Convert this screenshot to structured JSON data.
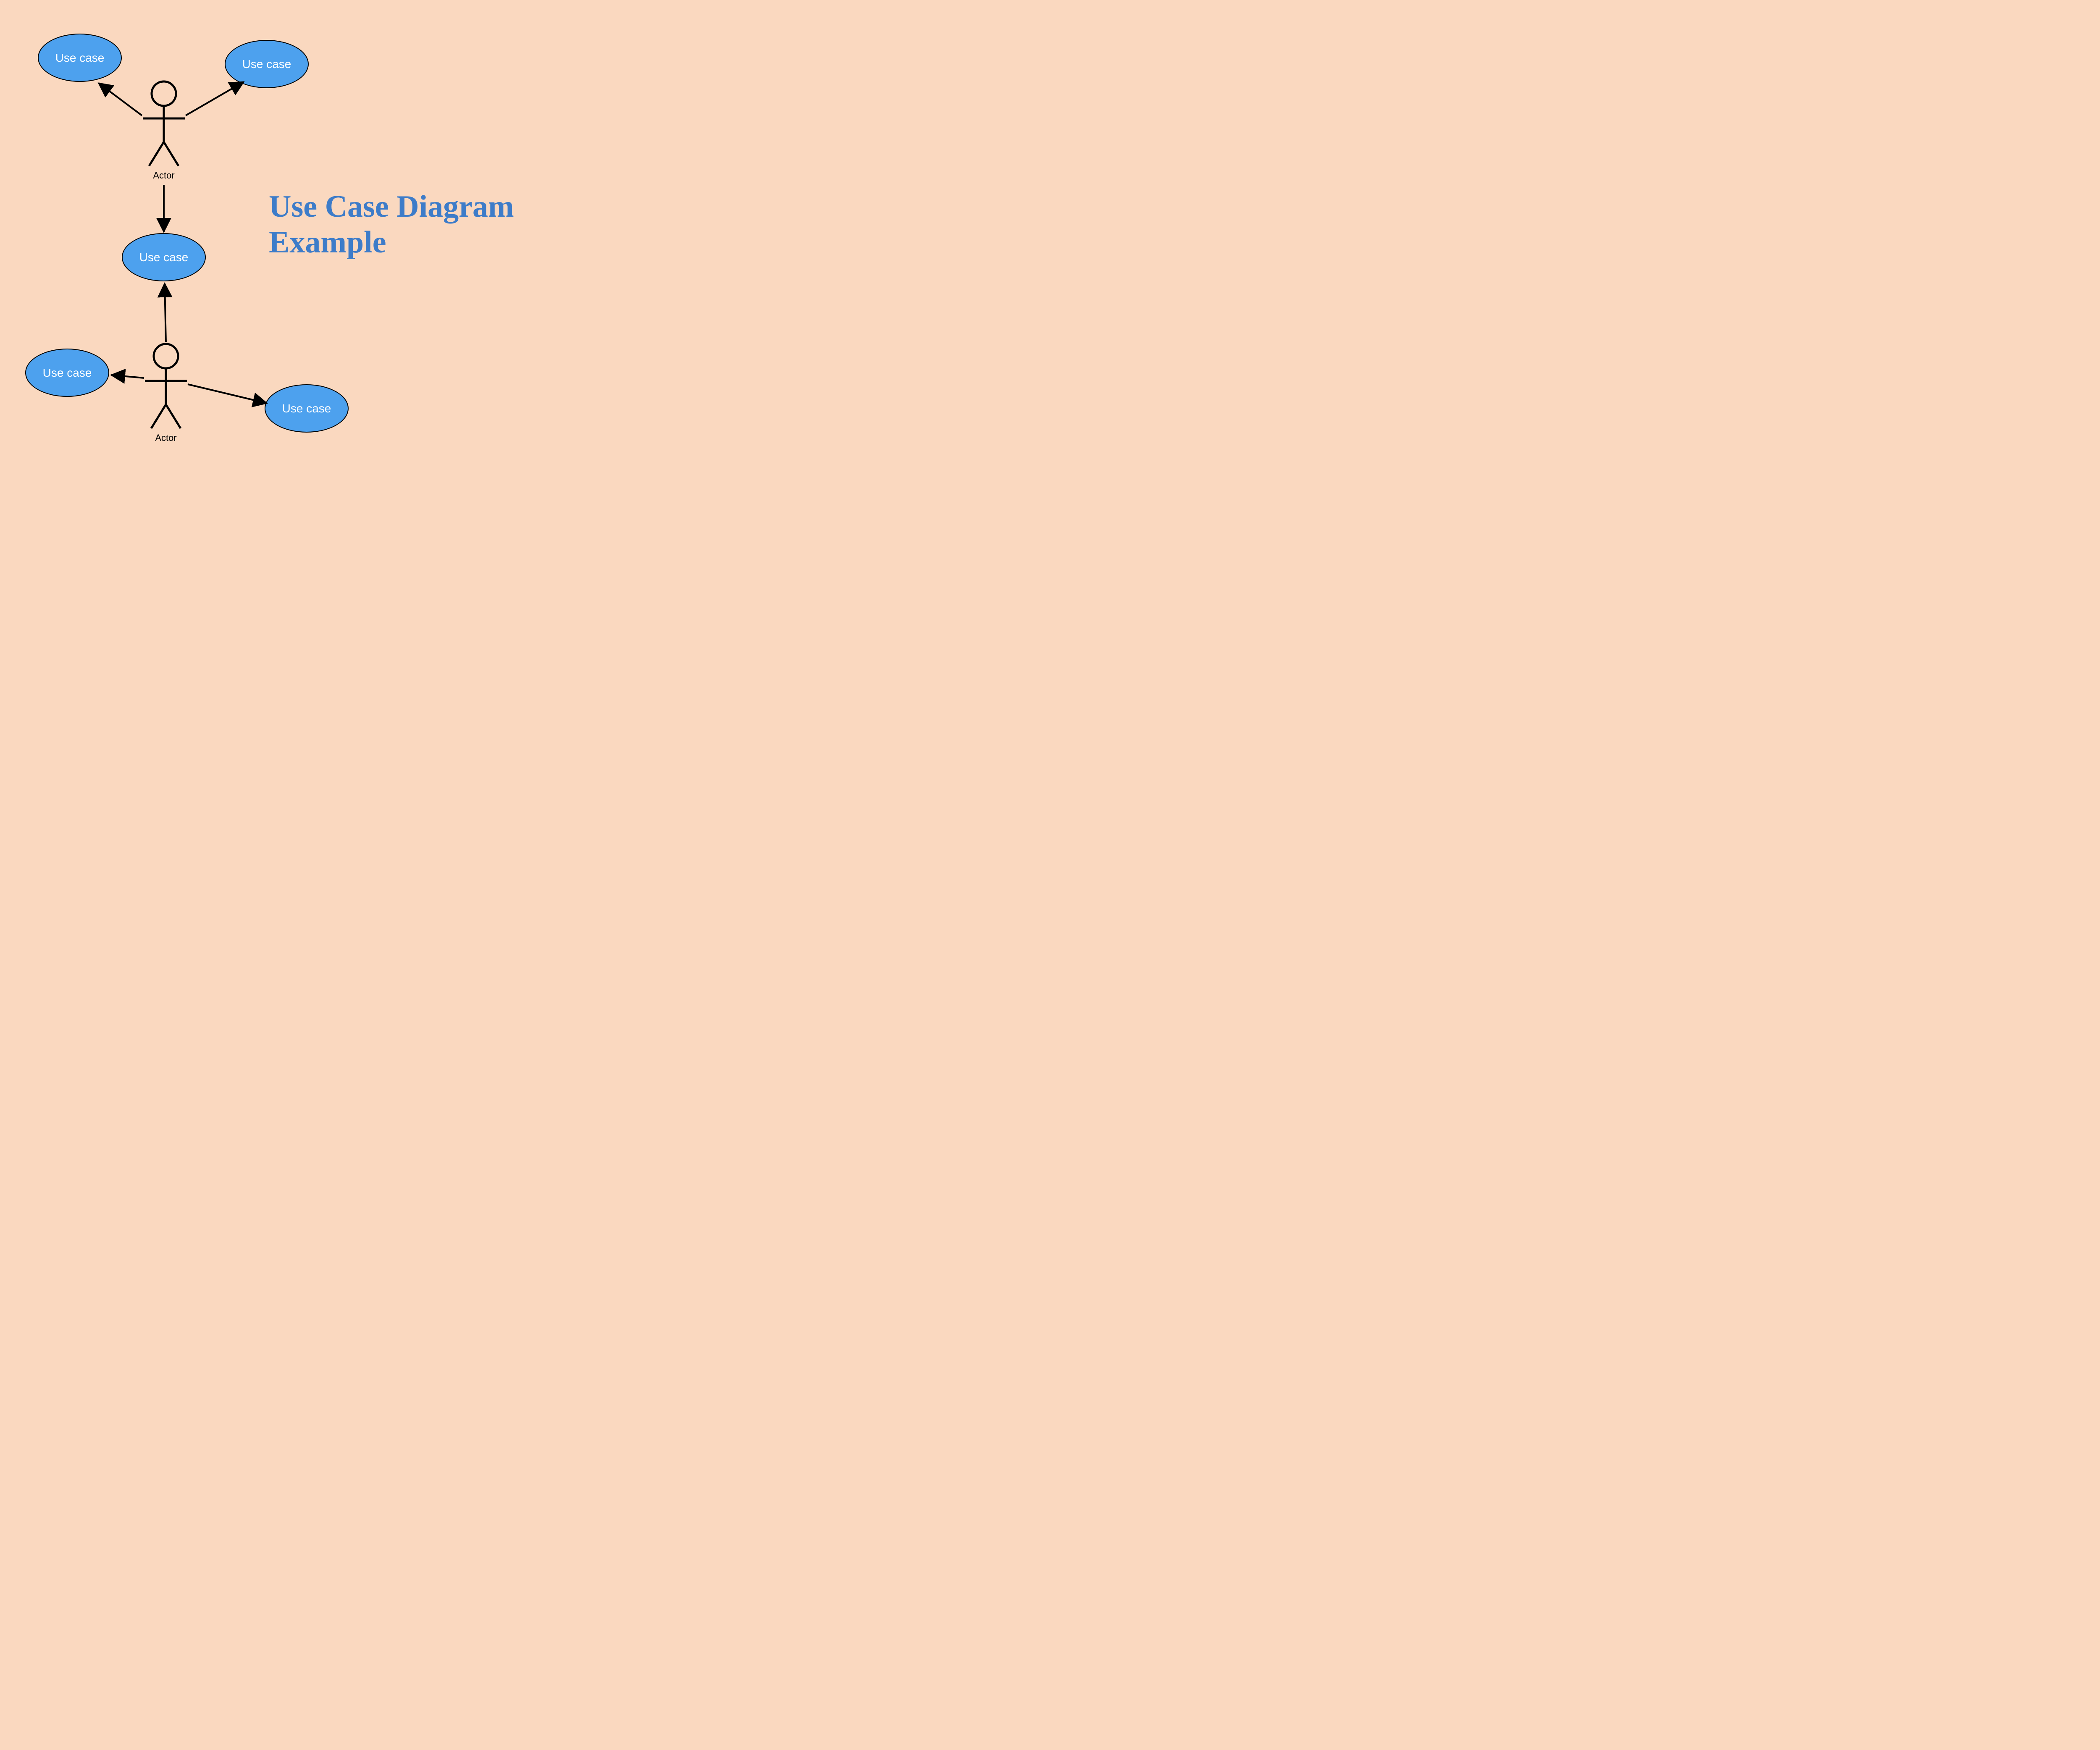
{
  "title": "Use Case Diagram Example",
  "usecases": {
    "uc1": "Use case",
    "uc2": "Use case",
    "uc3": "Use case",
    "uc4": "Use case",
    "uc5": "Use case"
  },
  "actors": {
    "a1": "Actor",
    "a2": "Actor"
  },
  "colors": {
    "bg": "#fad8bf",
    "ellipseFill": "#4da1ee",
    "ellipseStroke": "#000000",
    "title": "#3d7cc9",
    "line": "#000000"
  }
}
